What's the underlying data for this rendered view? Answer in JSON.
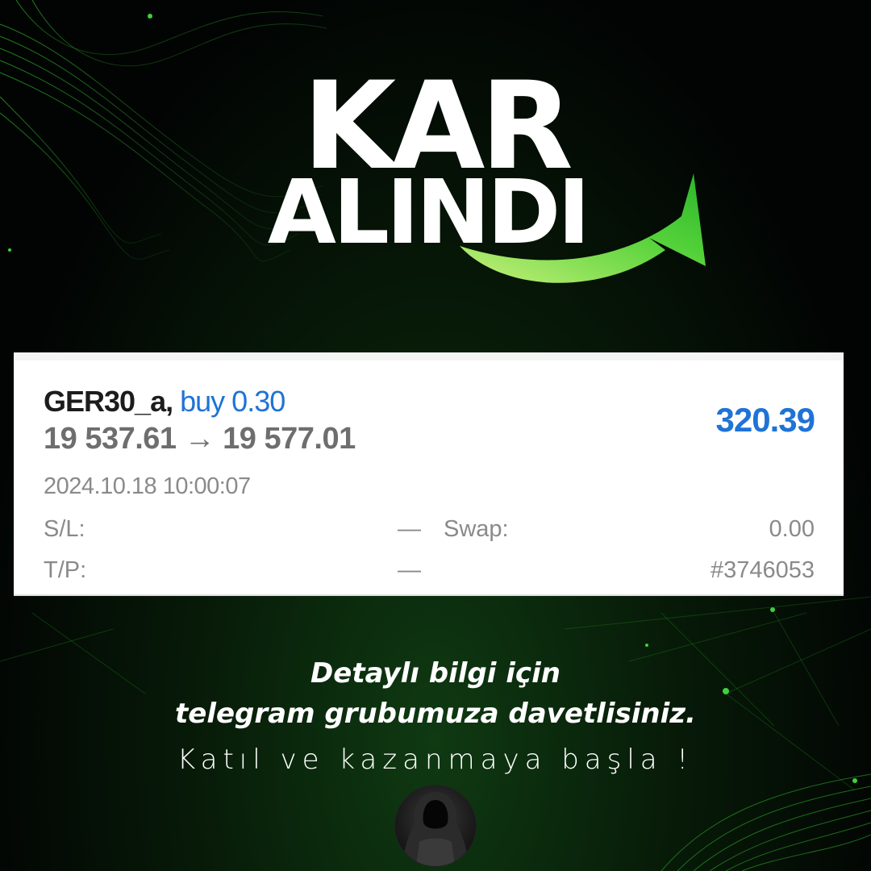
{
  "headline": {
    "line1": "KAR",
    "line2": "ALINDI"
  },
  "trade": {
    "symbol": "GER30_a,",
    "side": "buy 0.30",
    "prices": "19 537.61 → 19 577.01",
    "profit": "320.39",
    "datetime": "2024.10.18 10:00:07",
    "sl_label": "S/L:",
    "sl_value": "—",
    "swap_label": "Swap:",
    "swap_value": "0.00",
    "tp_label": "T/P:",
    "tp_value": "—",
    "ticket": "#3746053"
  },
  "info": {
    "line1": "Detaylı bilgi için",
    "line2": "telegram grubumuza davetlisiniz.",
    "line3": "Katıl ve kazanmaya başla !"
  },
  "colors": {
    "background": "#020403",
    "accent_green": "#3fd13a",
    "profit_blue": "#1f73d6"
  },
  "icons": {
    "arrow": "up-right-arrow-icon",
    "avatar": "hooded-figure-avatar"
  }
}
